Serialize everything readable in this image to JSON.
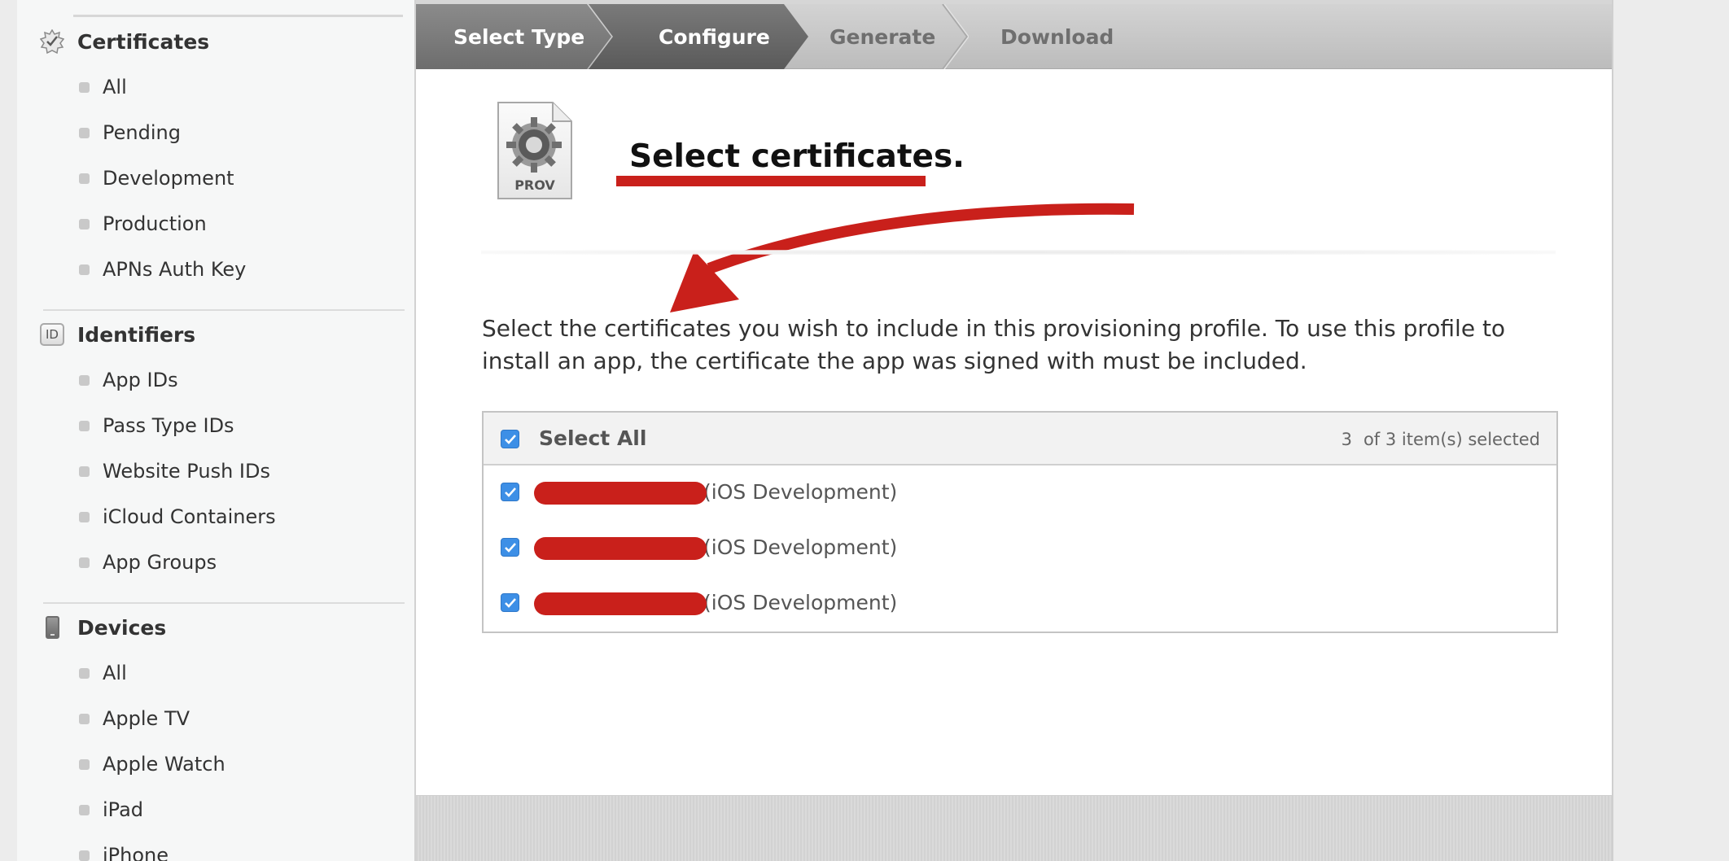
{
  "sidebar": {
    "certificates": {
      "title": "Certificates",
      "icon": "certificate-seal-icon",
      "items": [
        "All",
        "Pending",
        "Development",
        "Production",
        "APNs Auth Key"
      ]
    },
    "identifiers": {
      "title": "Identifiers",
      "icon": "id-badge-icon",
      "badge_text": "ID",
      "items": [
        "App IDs",
        "Pass Type IDs",
        "Website Push IDs",
        "iCloud Containers",
        "App Groups"
      ]
    },
    "devices": {
      "title": "Devices",
      "icon": "device-icon",
      "items": [
        "All",
        "Apple TV",
        "Apple Watch",
        "iPad",
        "iPhone"
      ]
    }
  },
  "steps": [
    {
      "label": "Select Type",
      "state": "done"
    },
    {
      "label": "Configure",
      "state": "current"
    },
    {
      "label": "Generate",
      "state": "todo"
    },
    {
      "label": "Download",
      "state": "todo"
    }
  ],
  "content": {
    "prov_icon_text": "PROV",
    "heading": "Select certificates.",
    "description": "Select the certificates you wish to include in this provisioning profile. To use this profile to install an app, the certificate the app was signed with must be included."
  },
  "cert_table": {
    "select_all_label": "Select All",
    "selected_count": "3",
    "count_suffix": "of 3 item(s) selected",
    "rows": [
      {
        "type_label": "(iOS Development)",
        "checked": true
      },
      {
        "type_label": "(iOS Development)",
        "checked": true
      },
      {
        "type_label": "(iOS Development)",
        "checked": true
      }
    ]
  },
  "colors": {
    "annotation_red": "#c9201b",
    "checkbox_blue": "#3d8fe6"
  }
}
